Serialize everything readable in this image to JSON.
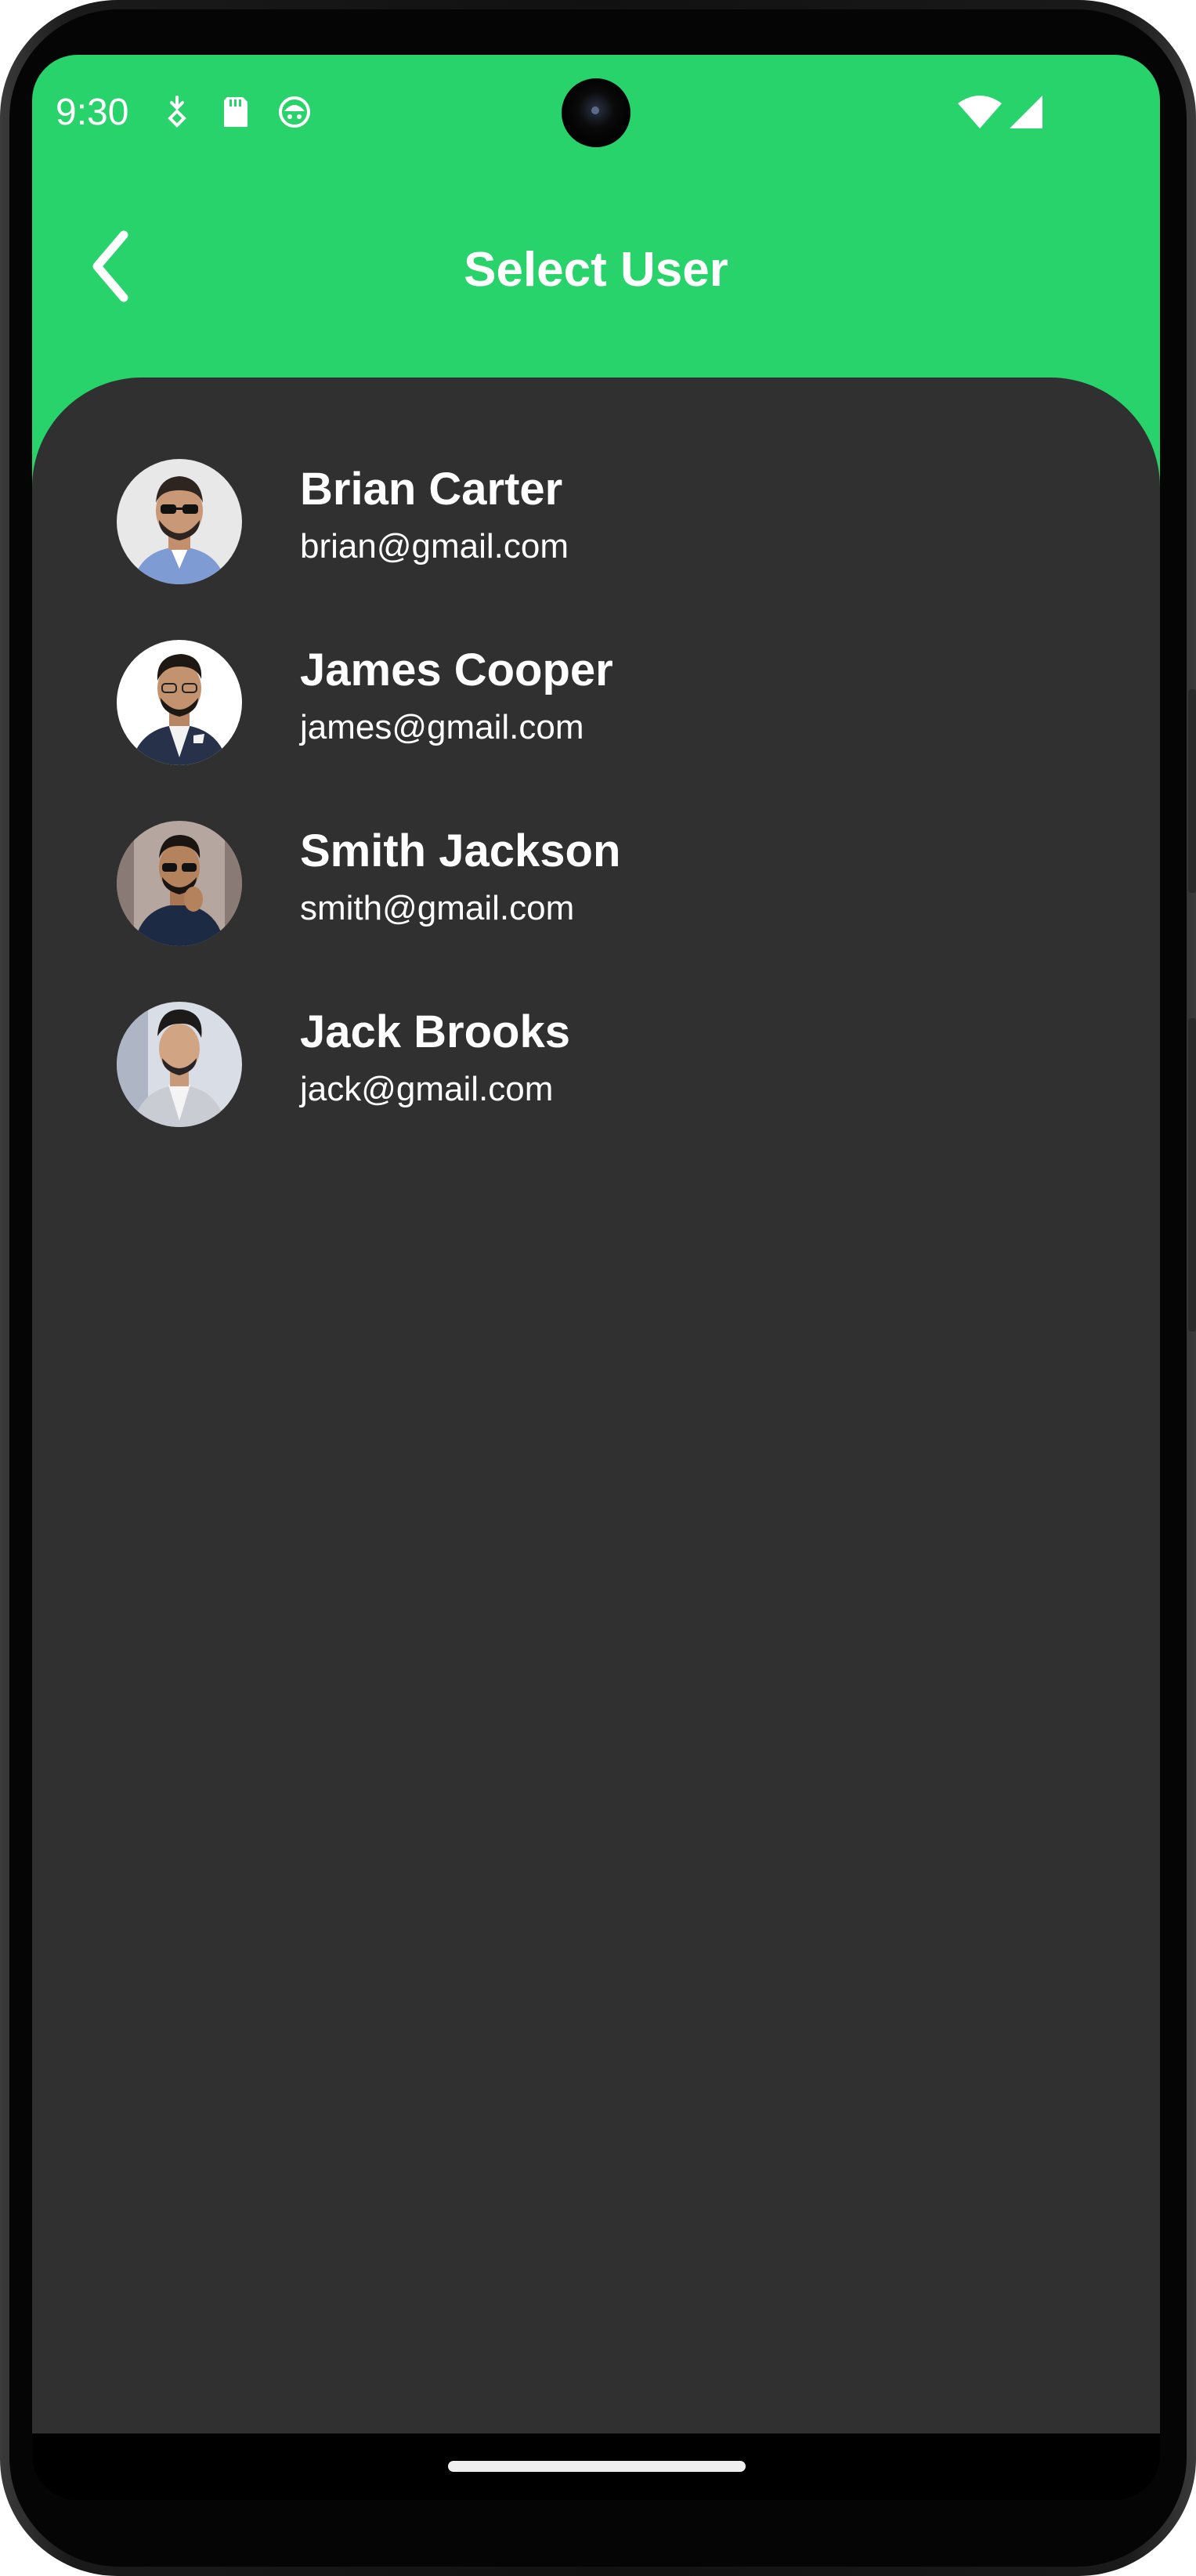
{
  "status_bar": {
    "time": "9:30",
    "icons": [
      "notification-icon",
      "sd-card-icon",
      "android-icon",
      "wifi-icon",
      "signal-icon"
    ]
  },
  "app_bar": {
    "title": "Select User",
    "back_icon": "chevron-left-icon"
  },
  "colors": {
    "header": "#27d36a",
    "background": "#303030",
    "text": "#ffffff"
  },
  "users": [
    {
      "name": "Brian Carter",
      "email": "brian@gmail.com",
      "avatar": "avatar-photo"
    },
    {
      "name": "James Cooper",
      "email": "james@gmail.com",
      "avatar": "avatar-photo"
    },
    {
      "name": "Smith Jackson",
      "email": "smith@gmail.com",
      "avatar": "avatar-photo"
    },
    {
      "name": "Jack Brooks",
      "email": "jack@gmail.com",
      "avatar": "avatar-photo"
    }
  ]
}
